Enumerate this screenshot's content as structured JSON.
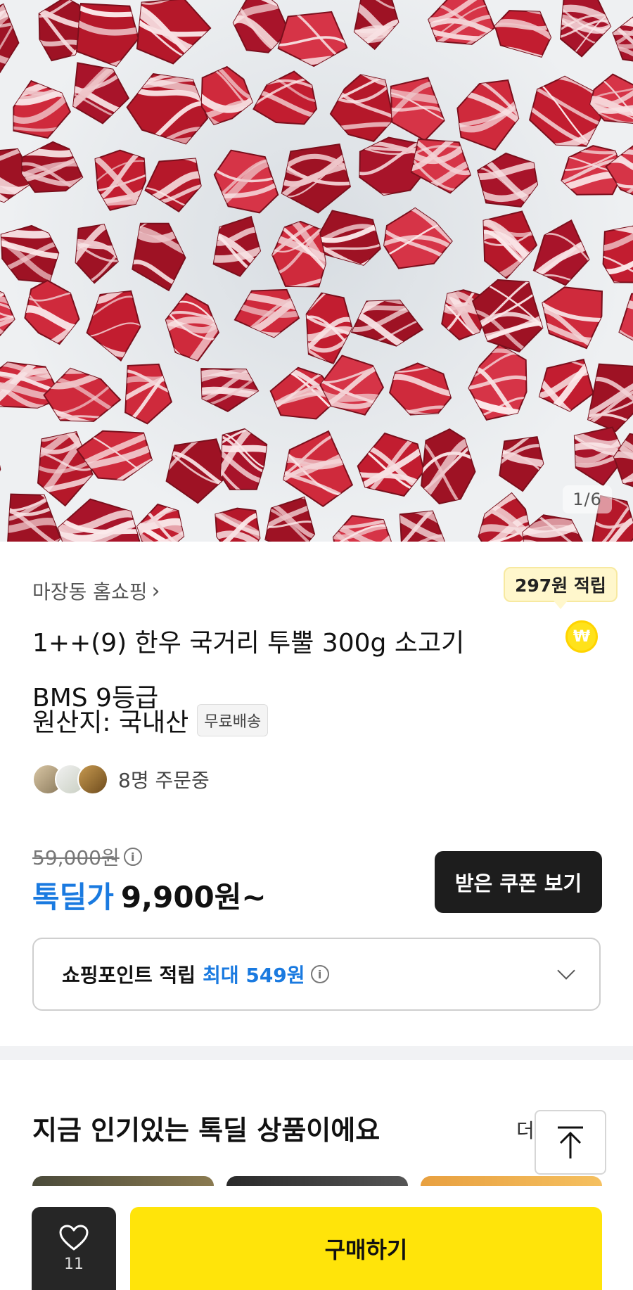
{
  "hero": {
    "image_alt": "marbled beef cubes",
    "counter": "1/6"
  },
  "product": {
    "seller": "마장동 홈쇼핑",
    "point_bubble": "297원 적립",
    "coin_symbol": "₩",
    "title_line1": "1++(9) 한우 국거리 투뿔 300g 소고기",
    "title_line2": "BMS 9등급",
    "origin": "원산지: 국내산",
    "badge_free_shipping": "무료배송",
    "buyers_text": "8명 주문중"
  },
  "price": {
    "original": "59,000원",
    "deal_label": "톡딜가",
    "deal_price": "9,900원~",
    "coupon_button": "받은 쿠폰 보기",
    "info_symbol": "i"
  },
  "points": {
    "label": "쇼핑포인트 적립",
    "max_text": "최대 549원"
  },
  "popular": {
    "title": "지금 인기있는 톡딜 상품이에요",
    "more": "더"
  },
  "bottom_bar": {
    "like_count": "11",
    "buy_label": "구매하기"
  },
  "colors": {
    "accent_blue": "#1a7ae0",
    "buy_yellow": "#ffe40a",
    "dark": "#1d1d1d"
  }
}
